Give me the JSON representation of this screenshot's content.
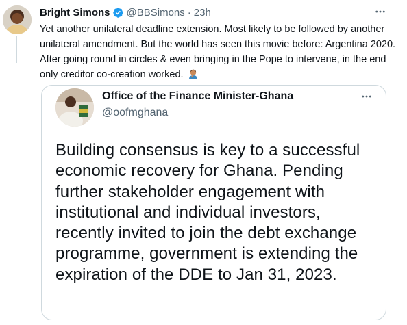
{
  "tweet": {
    "author_name": "Bright Simons",
    "author_handle": "@BBSimons",
    "separator": "·",
    "time": "23h",
    "verified_icon": "verified-badge-icon",
    "text": "Yet another unilateral deadline extension. Most likely to be followed by another unilateral amendment. But the world has seen this movie before: Argentina 2020. After going round in circles & even bringing in the Pope to intervene, in the end only creditor co-creation worked.",
    "emoji": "person-facepalming-emoji"
  },
  "quoted_tweet": {
    "author_name": "Office of the Finance Minister-Ghana",
    "author_handle": "@oofmghana",
    "text": "Building consensus is key to a successful economic recovery for Ghana. Pending further stakeholder engagement with institutional and individual investors, recently invited to join the debt exchange programme, government is extending the expiration of the DDE to Jan 31, 2023."
  },
  "colors": {
    "verified_blue": "#1d9bf0",
    "secondary_text": "#536471",
    "border": "#cfd9de"
  }
}
